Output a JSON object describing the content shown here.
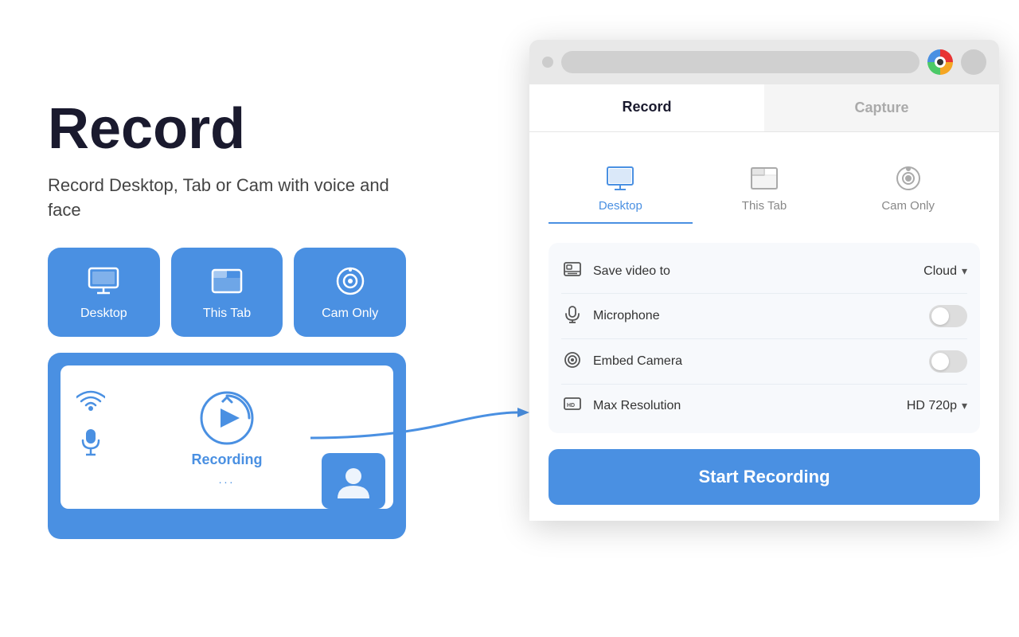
{
  "page": {
    "title": "Record",
    "subtitle": "Record Desktop, Tab or Cam with voice and face"
  },
  "mode_buttons": [
    {
      "id": "desktop",
      "label": "Desktop"
    },
    {
      "id": "this-tab",
      "label": "This Tab"
    },
    {
      "id": "cam-only",
      "label": "Cam Only"
    }
  ],
  "preview": {
    "recording_label": "Recording",
    "recording_dots": "..."
  },
  "popup": {
    "tabs": [
      {
        "id": "record",
        "label": "Record",
        "active": true
      },
      {
        "id": "capture",
        "label": "Capture",
        "active": false
      }
    ],
    "record_modes": [
      {
        "id": "desktop",
        "label": "Desktop",
        "active": true
      },
      {
        "id": "this-tab",
        "label": "This Tab",
        "active": false
      },
      {
        "id": "cam-only",
        "label": "Cam Only",
        "active": false
      }
    ],
    "settings": [
      {
        "id": "save-video-to",
        "label": "Save video to",
        "value": "Cloud",
        "type": "dropdown"
      },
      {
        "id": "microphone",
        "label": "Microphone",
        "value": "",
        "type": "toggle",
        "enabled": false
      },
      {
        "id": "embed-camera",
        "label": "Embed Camera",
        "value": "",
        "type": "toggle",
        "enabled": false
      },
      {
        "id": "max-resolution",
        "label": "Max Resolution",
        "value": "HD 720p",
        "type": "dropdown"
      }
    ],
    "start_button_label": "Start Recording"
  }
}
